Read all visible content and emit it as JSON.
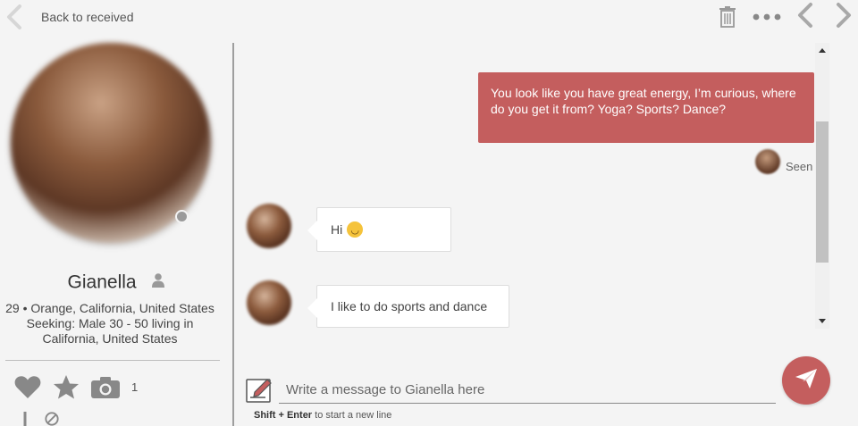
{
  "topbar": {
    "back_label": "Back to received",
    "icons": [
      "chevron-left-icon",
      "trash-icon",
      "more-horizontal-icon",
      "chevron-left-icon",
      "chevron-right-icon"
    ]
  },
  "profile": {
    "name": "Gianella",
    "info_line1": "29 • Orange, California, United States",
    "info_line2": "Seeking: Male 30 - 50 living in",
    "info_line3": "California, United States",
    "photo_count": "1",
    "status": "offline"
  },
  "messages": [
    {
      "direction": "out",
      "text": "You look like you have great energy, I’m curious, where do you get it from? Yoga? Sports? Dance?",
      "status": "Seen"
    },
    {
      "direction": "in",
      "text": "Hi",
      "emoji": "hugging-face"
    },
    {
      "direction": "in",
      "text": "I like to do sports and dance"
    }
  ],
  "compose": {
    "placeholder": "Write a message to Gianella here",
    "hint_keys": "Shift + Enter",
    "hint_text": "to start a new line"
  },
  "colors": {
    "accent": "#c45e5e",
    "background": "#f4f4f4",
    "icon_gray": "#888888"
  }
}
